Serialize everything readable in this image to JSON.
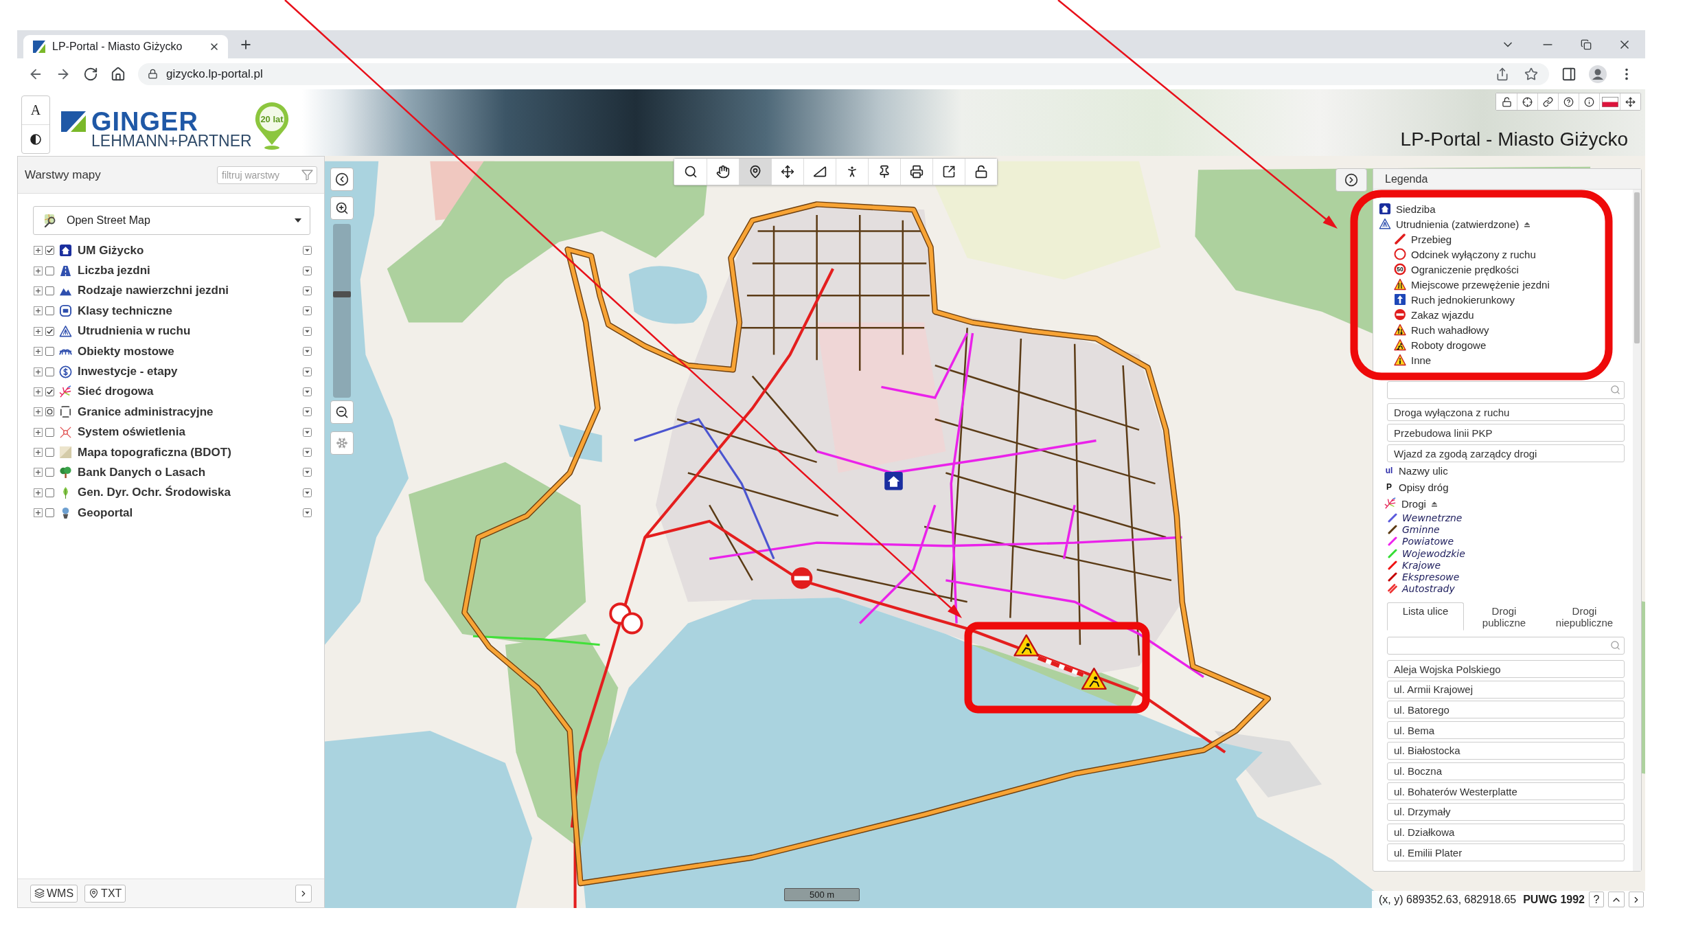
{
  "browser": {
    "tab_title": "LP-Portal - Miasto Giżycko",
    "url": "gizycko.lp-portal.pl"
  },
  "header": {
    "font_button": "A",
    "logo": {
      "name": "GINGER",
      "subtitle": "LEHMANN+PARTNER",
      "badge": "20 lat"
    },
    "title": "LP-Portal - Miasto Giżycko"
  },
  "layers_panel": {
    "title": "Warstwy mapy",
    "filter": {
      "placeholder": "filtruj warstwy"
    },
    "basemap": "Open Street Map",
    "layers": [
      {
        "label": "UM Giżycko",
        "checked": true,
        "partial": false,
        "expanded": false
      },
      {
        "label": "Liczba jezdni",
        "checked": false,
        "partial": false,
        "expanded": false
      },
      {
        "label": "Rodzaje nawierzchni jezdni",
        "checked": false,
        "partial": false,
        "expanded": false
      },
      {
        "label": "Klasy techniczne",
        "checked": false,
        "partial": false,
        "expanded": false
      },
      {
        "label": "Utrudnienia w ruchu",
        "checked": true,
        "partial": false,
        "expanded": false
      },
      {
        "label": "Obiekty mostowe",
        "checked": false,
        "partial": false,
        "expanded": false
      },
      {
        "label": "Inwestycje - etapy",
        "checked": false,
        "partial": false,
        "expanded": false
      },
      {
        "label": "Sieć drogowa",
        "checked": true,
        "partial": false,
        "expanded": false
      },
      {
        "label": "Granice administracyjne",
        "checked": false,
        "partial": true,
        "expanded": false
      },
      {
        "label": "System oświetlenia",
        "checked": false,
        "partial": false,
        "expanded": false
      },
      {
        "label": "Mapa topograficzna (BDOT)",
        "checked": false,
        "partial": false,
        "expanded": false
      },
      {
        "label": "Bank Danych o Lasach",
        "checked": false,
        "partial": false,
        "expanded": false
      },
      {
        "label": "Gen. Dyr. Ochr. Środowiska",
        "checked": false,
        "partial": false,
        "expanded": false
      },
      {
        "label": "Geoportal",
        "checked": false,
        "partial": false,
        "expanded": false
      }
    ],
    "footer_buttons": [
      "WMS",
      "TXT"
    ]
  },
  "map": {
    "toolbar": [
      {
        "kind": "search",
        "selected": false
      },
      {
        "kind": "pan",
        "selected": false
      },
      {
        "kind": "identify",
        "selected": true
      },
      {
        "kind": "move",
        "selected": false
      },
      {
        "kind": "measure",
        "selected": false
      },
      {
        "kind": "streetview",
        "selected": false
      },
      {
        "kind": "pin",
        "selected": false
      },
      {
        "kind": "print",
        "selected": false
      },
      {
        "kind": "export",
        "selected": false
      },
      {
        "kind": "unlock",
        "selected": false
      }
    ],
    "zoom": {
      "level": 0.6
    },
    "scale": "500 m",
    "status": {
      "coordinates": "(x, y) 689352.63, 682918.65",
      "projection": "PUWG 1992",
      "help": "?"
    }
  },
  "legend": {
    "title": "Legenda",
    "headquarters": "Siedziba",
    "obstructions": {
      "label": "Utrudnienia (zatwierdzone)",
      "expanded": true,
      "items": [
        {
          "kind": "route",
          "label": "Przebieg"
        },
        {
          "kind": "closed",
          "label": "Odcinek wyłączony z ruchu"
        },
        {
          "kind": "speed",
          "label": "Ograniczenie prędkości",
          "sign_text": "50"
        },
        {
          "kind": "narrowing",
          "label": "Miejscowe przewężenie jezdni"
        },
        {
          "kind": "oneway",
          "label": "Ruch jednokierunkowy"
        },
        {
          "kind": "noentry",
          "label": "Zakaz wjazdu"
        },
        {
          "kind": "alternating",
          "label": "Ruch wahadłowy"
        },
        {
          "kind": "roadworks",
          "label": "Roboty drogowe"
        },
        {
          "kind": "other",
          "label": "Inne"
        }
      ]
    },
    "filters": [
      "Droga wyłączona z ruchu",
      "Przebudowa linii PKP",
      "Wjazd za zgodą zarządcy drogi"
    ],
    "overlays": [
      {
        "badge": "ul",
        "label": "Nazwy ulic"
      },
      {
        "badge": "P",
        "label": "Opisy dróg"
      }
    ],
    "roads": {
      "label": "Drogi",
      "expanded": true,
      "types": [
        {
          "label": "Wewnetrzne",
          "kind": "line",
          "color": "#5a5adc"
        },
        {
          "label": "Gminne",
          "kind": "line",
          "color": "#5c3a12"
        },
        {
          "label": "Powiatowe",
          "kind": "line",
          "color": "#ee22ee"
        },
        {
          "label": "Wojewodzkie",
          "kind": "line",
          "color": "#33dd33"
        },
        {
          "label": "Krajowe",
          "kind": "line",
          "color": "#ee1111"
        },
        {
          "label": "Ekspresowe",
          "kind": "line",
          "color": "#c40000"
        },
        {
          "label": "Autostrady",
          "kind": "outline",
          "color": "#ee3333"
        }
      ]
    },
    "tabs": [
      {
        "label": "Lista ulice",
        "selected": true
      },
      {
        "label": "Drogi publiczne",
        "selected": false
      },
      {
        "label": "Drogi niepubliczne",
        "selected": false
      }
    ],
    "streets": [
      "Aleja Wojska Polskiego",
      "ul. Armii Krajowej",
      "ul. Batorego",
      "ul. Bema",
      "ul. Białostocka",
      "ul. Boczna",
      "ul. Bohaterów Westerplatte",
      "ul. Drzymały",
      "ul. Działkowa",
      "ul. Emilii Plater"
    ]
  }
}
